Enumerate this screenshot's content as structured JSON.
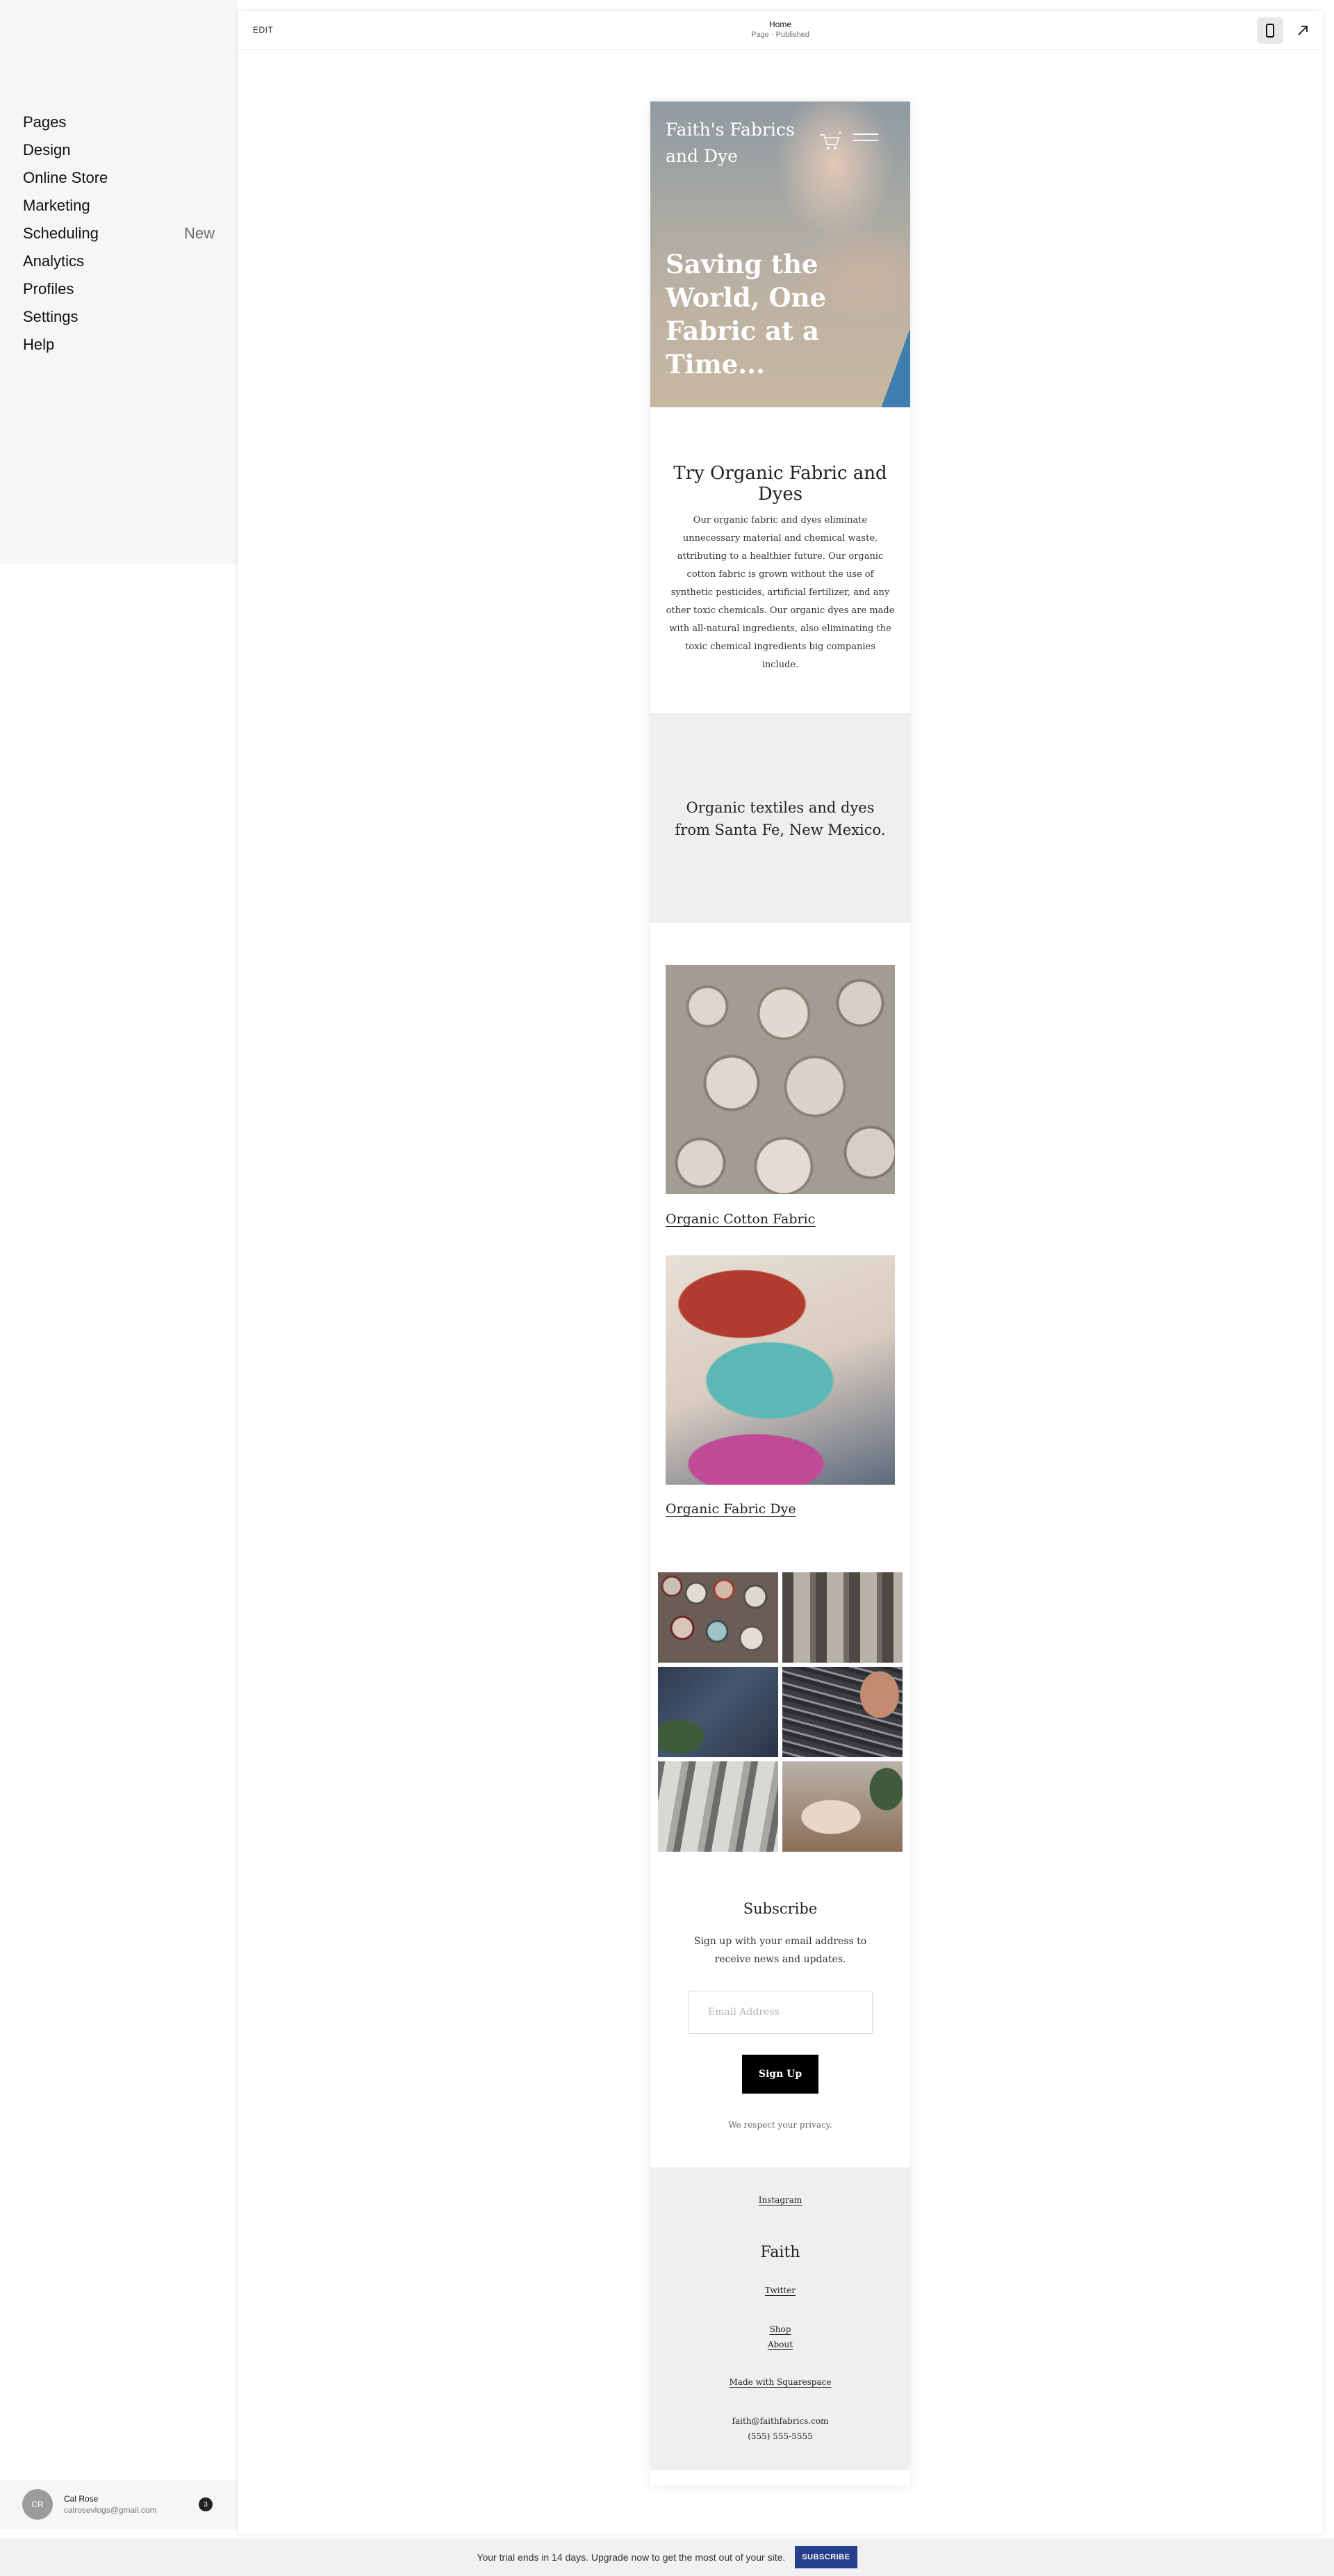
{
  "sidebar": {
    "items": [
      {
        "label": "Pages",
        "badge": ""
      },
      {
        "label": "Design",
        "badge": ""
      },
      {
        "label": "Online Store",
        "badge": ""
      },
      {
        "label": "Marketing",
        "badge": ""
      },
      {
        "label": "Scheduling",
        "badge": "New"
      },
      {
        "label": "Analytics",
        "badge": ""
      },
      {
        "label": "Profiles",
        "badge": ""
      },
      {
        "label": "Settings",
        "badge": ""
      },
      {
        "label": "Help",
        "badge": ""
      }
    ],
    "user": {
      "initials": "CR",
      "name": "Cal Rose",
      "email": "calrosevlogs@gmail.com",
      "notifications": "3"
    }
  },
  "topbar": {
    "edit_label": "EDIT",
    "page_title": "Home",
    "page_status": "Page · Published",
    "device_icon": "mobile-phone-icon",
    "expand_icon": "arrow-up-right-icon"
  },
  "site": {
    "brand": "Faith's Fabrics and Dye",
    "cart_icon": "cart-icon",
    "menu_icon": "hamburger-menu-icon",
    "hero_headline": "Saving the World, One Fabric at a Time...",
    "intro_title": "Try Organic Fabric and Dyes",
    "intro_body": "Our organic fabric and dyes eliminate unnecessary material and chemical waste, attributing to a healthier future. Our organic cotton fabric is grown without the use of synthetic pesticides, artificial fertilizer, and any other toxic chemicals. Our organic dyes are made with all-natural ingredients, also eliminating the toxic chemical ingredients big companies include.",
    "band_text": "Organic textiles and dyes from Santa Fe, New Mexico.",
    "products": [
      {
        "label": "Organic Cotton Fabric"
      },
      {
        "label": "Organic Fabric Dye"
      }
    ],
    "subscribe": {
      "title": "Subscribe",
      "description": "Sign up with your email address to receive news and updates.",
      "email_placeholder": "Email Address",
      "button_label": "Sign Up",
      "privacy": "We respect your privacy."
    },
    "footer": {
      "instagram": "Instagram",
      "brand": "Faith",
      "twitter": "Twitter",
      "shop": "Shop",
      "about": "About",
      "made_with": "Made with Squarespace",
      "email": "faith@faithfabrics.com",
      "phone": "(555) 555-5555"
    }
  },
  "trial": {
    "message": "Your trial ends in 14 days. Upgrade now to get the most out of your site.",
    "button_label": "SUBSCRIBE"
  },
  "colors": {
    "sidebar_bg": "#f6f6f6",
    "band_bg": "#f0efed",
    "signup_button": "#000000",
    "subscribe_button": "#26408b"
  }
}
